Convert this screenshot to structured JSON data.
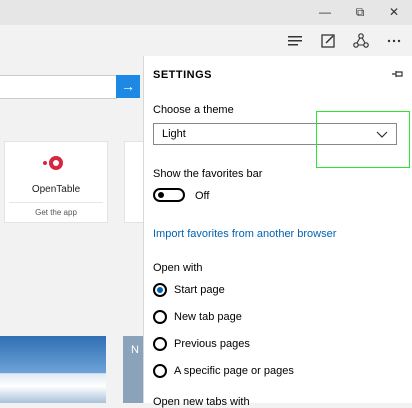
{
  "window": {
    "minimize": "—",
    "restore": "⧉",
    "close": "✕"
  },
  "toolbar": {
    "icons": [
      "hub-icon",
      "note-icon",
      "share-icon",
      "more-icon"
    ]
  },
  "page": {
    "tile": {
      "name": "OpenTable",
      "action": "Get the app"
    },
    "photo2_label": "N"
  },
  "settings": {
    "title": "SETTINGS",
    "theme_label": "Choose a theme",
    "theme_value": "Light",
    "favorites_label": "Show the favorites bar",
    "favorites_state": "Off",
    "import_link": "Import favorites from another browser",
    "open_with_label": "Open with",
    "open_with_options": [
      {
        "label": "Start page",
        "checked": true
      },
      {
        "label": "New tab page",
        "checked": false
      },
      {
        "label": "Previous pages",
        "checked": false
      },
      {
        "label": "A specific page or pages",
        "checked": false
      }
    ],
    "new_tabs_label": "Open new tabs with"
  },
  "colors": {
    "accent": "#0063b1",
    "go_button": "#1e88e5",
    "highlight": "#2ee52e"
  }
}
